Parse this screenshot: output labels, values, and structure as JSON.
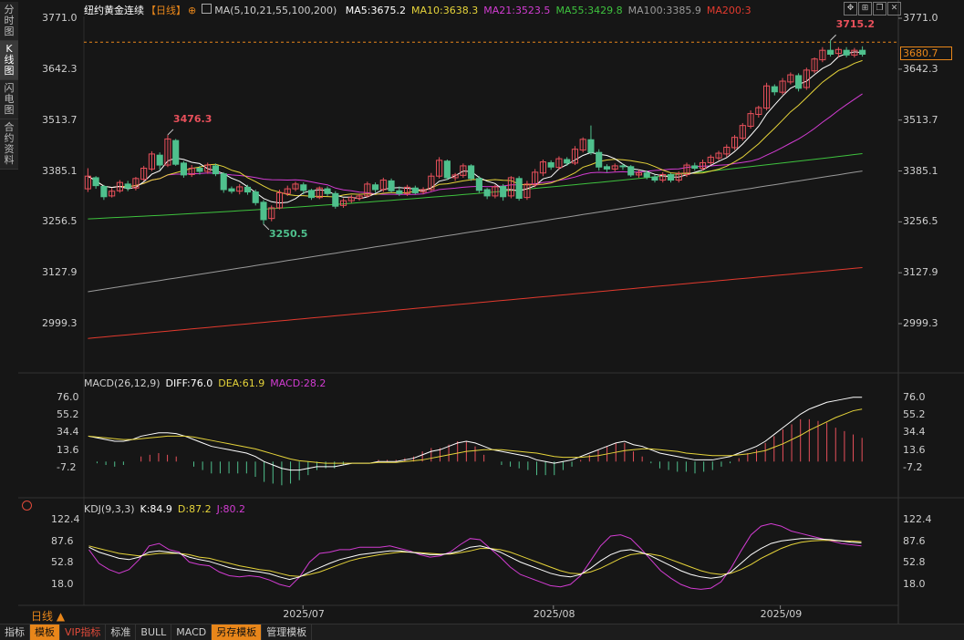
{
  "side_tabs": [
    "分时图",
    "K线图",
    "闪电图",
    "合约资料"
  ],
  "side_active": 1,
  "header": {
    "title": "纽约黄金连续",
    "period": "【日线】",
    "plus": "⊕",
    "ma_params": "MA(5,10,21,55,100,200)",
    "ma": [
      {
        "label": "MA5:3675.2",
        "color": "#ffffff"
      },
      {
        "label": "MA10:3638.3",
        "color": "#e6d43a"
      },
      {
        "label": "MA21:3523.5",
        "color": "#d23cd2"
      },
      {
        "label": "MA55:3429.8",
        "color": "#3ec23e"
      },
      {
        "label": "MA100:3385.9",
        "color": "#9a9a9a"
      },
      {
        "label": "MA200:3",
        "color": "#e23a2e"
      }
    ]
  },
  "price_axis_left": [
    "3771.0",
    "3642.3",
    "3513.7",
    "3385.1",
    "3256.5",
    "3127.9",
    "2999.3"
  ],
  "price_axis_right": [
    "3771.0",
    "3642.3",
    "3513.7",
    "3385.1",
    "3256.5",
    "3127.9",
    "2999.3"
  ],
  "current_price": "3680.7",
  "annotations": {
    "high1": "3476.3",
    "low1": "3250.5",
    "high2": "3715.2"
  },
  "macd_header": {
    "params": "MACD(26,12,9)",
    "diff": "DIFF:76.0",
    "dea": "DEA:61.9",
    "macd": "MACD:28.2"
  },
  "macd_axis": [
    "76.0",
    "55.2",
    "34.4",
    "13.6",
    "-7.2"
  ],
  "kdj_header": {
    "params": "KDJ(9,3,3)",
    "k": "K:84.9",
    "d": "D:87.2",
    "j": "J:80.2"
  },
  "kdj_axis": [
    "122.4",
    "87.6",
    "52.8",
    "18.0"
  ],
  "x_labels": [
    "2025/07",
    "2025/08",
    "2025/09"
  ],
  "period_label": "日线 ▲",
  "bottom_tabs": [
    {
      "label": "指标",
      "style": ""
    },
    {
      "label": "模板",
      "style": "orange"
    },
    {
      "label": "VIP指标",
      "style": "vip"
    },
    {
      "label": "标准",
      "style": ""
    },
    {
      "label": "BULL",
      "style": ""
    },
    {
      "label": "MACD",
      "style": ""
    },
    {
      "label": "另存模板",
      "style": "orange"
    },
    {
      "label": "管理模板",
      "style": ""
    }
  ],
  "colors": {
    "up": "#e8505b",
    "down": "#4fc08d",
    "ma5": "#ffffff",
    "ma10": "#e6d43a",
    "ma21": "#d23cd2",
    "ma55": "#3ec23e",
    "ma100": "#9a9a9a",
    "ma200": "#e23a2e",
    "accent": "#e8861a"
  },
  "chart_data": {
    "type": "candlestick",
    "ylim": [
      2960,
      3790
    ],
    "candles": [
      [
        3340,
        3372,
        3332,
        3392
      ],
      [
        3368,
        3348,
        3340,
        3372
      ],
      [
        3346,
        3320,
        3312,
        3350
      ],
      [
        3322,
        3334,
        3318,
        3342
      ],
      [
        3335,
        3356,
        3330,
        3362
      ],
      [
        3352,
        3342,
        3334,
        3360
      ],
      [
        3342,
        3366,
        3336,
        3370
      ],
      [
        3364,
        3392,
        3360,
        3398
      ],
      [
        3390,
        3428,
        3385,
        3435
      ],
      [
        3425,
        3400,
        3388,
        3432
      ],
      [
        3400,
        3466,
        3395,
        3476
      ],
      [
        3462,
        3402,
        3398,
        3466
      ],
      [
        3405,
        3375,
        3368,
        3410
      ],
      [
        3376,
        3392,
        3370,
        3400
      ],
      [
        3392,
        3384,
        3376,
        3398
      ],
      [
        3384,
        3400,
        3378,
        3406
      ],
      [
        3398,
        3378,
        3372,
        3404
      ],
      [
        3378,
        3338,
        3330,
        3382
      ],
      [
        3340,
        3334,
        3328,
        3346
      ],
      [
        3334,
        3345,
        3326,
        3352
      ],
      [
        3344,
        3332,
        3325,
        3350
      ],
      [
        3332,
        3305,
        3298,
        3338
      ],
      [
        3306,
        3262,
        3250,
        3312
      ],
      [
        3265,
        3292,
        3258,
        3298
      ],
      [
        3292,
        3330,
        3288,
        3338
      ],
      [
        3328,
        3340,
        3322,
        3348
      ],
      [
        3340,
        3352,
        3334,
        3358
      ],
      [
        3350,
        3336,
        3326,
        3356
      ],
      [
        3336,
        3318,
        3312,
        3340
      ],
      [
        3318,
        3342,
        3314,
        3346
      ],
      [
        3340,
        3328,
        3322,
        3346
      ],
      [
        3328,
        3296,
        3290,
        3334
      ],
      [
        3298,
        3310,
        3292,
        3316
      ],
      [
        3310,
        3318,
        3304,
        3324
      ],
      [
        3316,
        3322,
        3310,
        3328
      ],
      [
        3322,
        3352,
        3318,
        3358
      ],
      [
        3350,
        3338,
        3330,
        3356
      ],
      [
        3338,
        3362,
        3332,
        3368
      ],
      [
        3360,
        3335,
        3330,
        3366
      ],
      [
        3335,
        3328,
        3322,
        3346
      ],
      [
        3328,
        3344,
        3322,
        3350
      ],
      [
        3342,
        3330,
        3326,
        3348
      ],
      [
        3332,
        3338,
        3326,
        3344
      ],
      [
        3338,
        3372,
        3334,
        3380
      ],
      [
        3372,
        3412,
        3366,
        3420
      ],
      [
        3410,
        3368,
        3362,
        3414
      ],
      [
        3368,
        3375,
        3360,
        3380
      ],
      [
        3374,
        3398,
        3368,
        3404
      ],
      [
        3398,
        3366,
        3360,
        3402
      ],
      [
        3366,
        3336,
        3330,
        3372
      ],
      [
        3338,
        3322,
        3314,
        3342
      ],
      [
        3322,
        3345,
        3316,
        3350
      ],
      [
        3346,
        3320,
        3310,
        3352
      ],
      [
        3322,
        3368,
        3316,
        3372
      ],
      [
        3366,
        3316,
        3310,
        3372
      ],
      [
        3318,
        3352,
        3312,
        3360
      ],
      [
        3350,
        3382,
        3344,
        3390
      ],
      [
        3380,
        3408,
        3372,
        3414
      ],
      [
        3406,
        3395,
        3388,
        3412
      ],
      [
        3394,
        3416,
        3388,
        3422
      ],
      [
        3414,
        3405,
        3398,
        3420
      ],
      [
        3405,
        3440,
        3400,
        3448
      ],
      [
        3438,
        3465,
        3432,
        3470
      ],
      [
        3464,
        3432,
        3426,
        3500
      ],
      [
        3432,
        3395,
        3386,
        3440
      ],
      [
        3396,
        3390,
        3382,
        3402
      ],
      [
        3390,
        3398,
        3384,
        3404
      ],
      [
        3398,
        3396,
        3388,
        3404
      ],
      [
        3396,
        3375,
        3370,
        3400
      ],
      [
        3375,
        3380,
        3368,
        3388
      ],
      [
        3380,
        3370,
        3364,
        3386
      ],
      [
        3370,
        3362,
        3356,
        3376
      ],
      [
        3362,
        3376,
        3356,
        3382
      ],
      [
        3376,
        3362,
        3356,
        3380
      ],
      [
        3362,
        3378,
        3356,
        3384
      ],
      [
        3376,
        3400,
        3370,
        3406
      ],
      [
        3398,
        3392,
        3386,
        3406
      ],
      [
        3392,
        3406,
        3386,
        3414
      ],
      [
        3406,
        3420,
        3400,
        3426
      ],
      [
        3418,
        3430,
        3412,
        3436
      ],
      [
        3428,
        3445,
        3420,
        3452
      ],
      [
        3444,
        3470,
        3438,
        3476
      ],
      [
        3468,
        3500,
        3462,
        3506
      ],
      [
        3498,
        3530,
        3492,
        3538
      ],
      [
        3528,
        3545,
        3520,
        3550
      ],
      [
        3544,
        3600,
        3538,
        3608
      ],
      [
        3598,
        3585,
        3576,
        3604
      ],
      [
        3584,
        3612,
        3578,
        3620
      ],
      [
        3610,
        3628,
        3604,
        3634
      ],
      [
        3626,
        3594,
        3586,
        3632
      ],
      [
        3596,
        3640,
        3590,
        3646
      ],
      [
        3638,
        3668,
        3632,
        3672
      ],
      [
        3666,
        3690,
        3660,
        3698
      ],
      [
        3690,
        3680,
        3674,
        3715
      ],
      [
        3682,
        3692,
        3672,
        3698
      ],
      [
        3690,
        3678,
        3672,
        3698
      ],
      [
        3678,
        3690,
        3672,
        3696
      ],
      [
        3690,
        3680,
        3674,
        3700
      ]
    ],
    "ma_start": [
      3340,
      3350,
      3318,
      3264,
      3080,
      2962
    ],
    "ma_end": [
      3675,
      3638,
      3523,
      3429,
      3385,
      3141
    ],
    "macd_ylim": [
      -18,
      80
    ],
    "diff": [
      30,
      28,
      26,
      24,
      24,
      26,
      30,
      32,
      34,
      34,
      33,
      30,
      26,
      22,
      18,
      16,
      14,
      12,
      10,
      6,
      0,
      -4,
      -8,
      -10,
      -10,
      -8,
      -6,
      -6,
      -6,
      -4,
      -2,
      -2,
      -2,
      0,
      0,
      0,
      2,
      4,
      8,
      12,
      14,
      18,
      22,
      24,
      22,
      18,
      14,
      12,
      10,
      8,
      6,
      2,
      0,
      -2,
      0,
      2,
      6,
      10,
      14,
      18,
      22,
      24,
      20,
      18,
      14,
      10,
      8,
      6,
      4,
      2,
      2,
      2,
      4,
      6,
      10,
      14,
      18,
      24,
      32,
      40,
      48,
      56,
      62,
      66,
      70,
      72,
      74,
      76,
      76
    ],
    "dea": [
      30,
      29,
      28,
      27,
      26,
      26,
      27,
      28,
      29,
      30,
      30,
      30,
      29,
      27,
      25,
      23,
      21,
      19,
      17,
      15,
      12,
      9,
      6,
      3,
      1,
      0,
      -1,
      -2,
      -2,
      -2,
      -2,
      -2,
      -2,
      -1,
      -1,
      -1,
      0,
      1,
      2,
      4,
      6,
      8,
      10,
      12,
      13,
      14,
      14,
      14,
      13,
      12,
      11,
      10,
      8,
      6,
      5,
      5,
      5,
      6,
      7,
      9,
      11,
      13,
      14,
      15,
      15,
      14,
      13,
      12,
      10,
      9,
      8,
      7,
      7,
      7,
      8,
      9,
      11,
      13,
      17,
      21,
      26,
      31,
      37,
      42,
      47,
      52,
      56,
      60,
      62
    ],
    "kdj_ylim": [
      -5,
      130
    ],
    "k": [
      78,
      70,
      65,
      60,
      58,
      62,
      70,
      72,
      70,
      68,
      62,
      58,
      55,
      50,
      45,
      42,
      40,
      38,
      35,
      30,
      26,
      30,
      38,
      45,
      52,
      58,
      62,
      66,
      68,
      70,
      72,
      72,
      70,
      68,
      66,
      66,
      68,
      72,
      78,
      80,
      76,
      70,
      62,
      54,
      48,
      42,
      36,
      32,
      30,
      34,
      44,
      56,
      66,
      72,
      74,
      70,
      64,
      56,
      48,
      40,
      34,
      30,
      28,
      30,
      38,
      52,
      66,
      76,
      84,
      88,
      90,
      92,
      92,
      91,
      90,
      88,
      86,
      85
    ],
    "d": [
      80,
      76,
      72,
      68,
      66,
      64,
      66,
      68,
      68,
      68,
      66,
      62,
      60,
      56,
      52,
      48,
      45,
      42,
      40,
      36,
      32,
      31,
      34,
      38,
      44,
      50,
      56,
      60,
      63,
      66,
      68,
      70,
      70,
      69,
      68,
      67,
      67,
      69,
      72,
      76,
      76,
      74,
      70,
      64,
      58,
      52,
      46,
      40,
      36,
      35,
      38,
      44,
      52,
      60,
      66,
      68,
      67,
      64,
      58,
      52,
      46,
      40,
      36,
      34,
      36,
      42,
      50,
      60,
      68,
      76,
      82,
      86,
      88,
      89,
      89,
      88,
      88,
      87
    ],
    "j": [
      74,
      52,
      42,
      36,
      42,
      58,
      80,
      84,
      74,
      70,
      54,
      50,
      48,
      38,
      32,
      30,
      32,
      30,
      25,
      18,
      14,
      30,
      54,
      68,
      70,
      74,
      74,
      78,
      78,
      78,
      80,
      76,
      72,
      66,
      62,
      64,
      70,
      82,
      92,
      90,
      76,
      62,
      46,
      34,
      28,
      22,
      16,
      14,
      18,
      32,
      56,
      80,
      96,
      98,
      92,
      76,
      58,
      40,
      28,
      18,
      12,
      10,
      12,
      22,
      44,
      72,
      98,
      112,
      116,
      112,
      104,
      100,
      96,
      92,
      88,
      84,
      82,
      80
    ],
    "x_label_fractions": [
      0.28,
      0.6,
      0.89
    ]
  }
}
